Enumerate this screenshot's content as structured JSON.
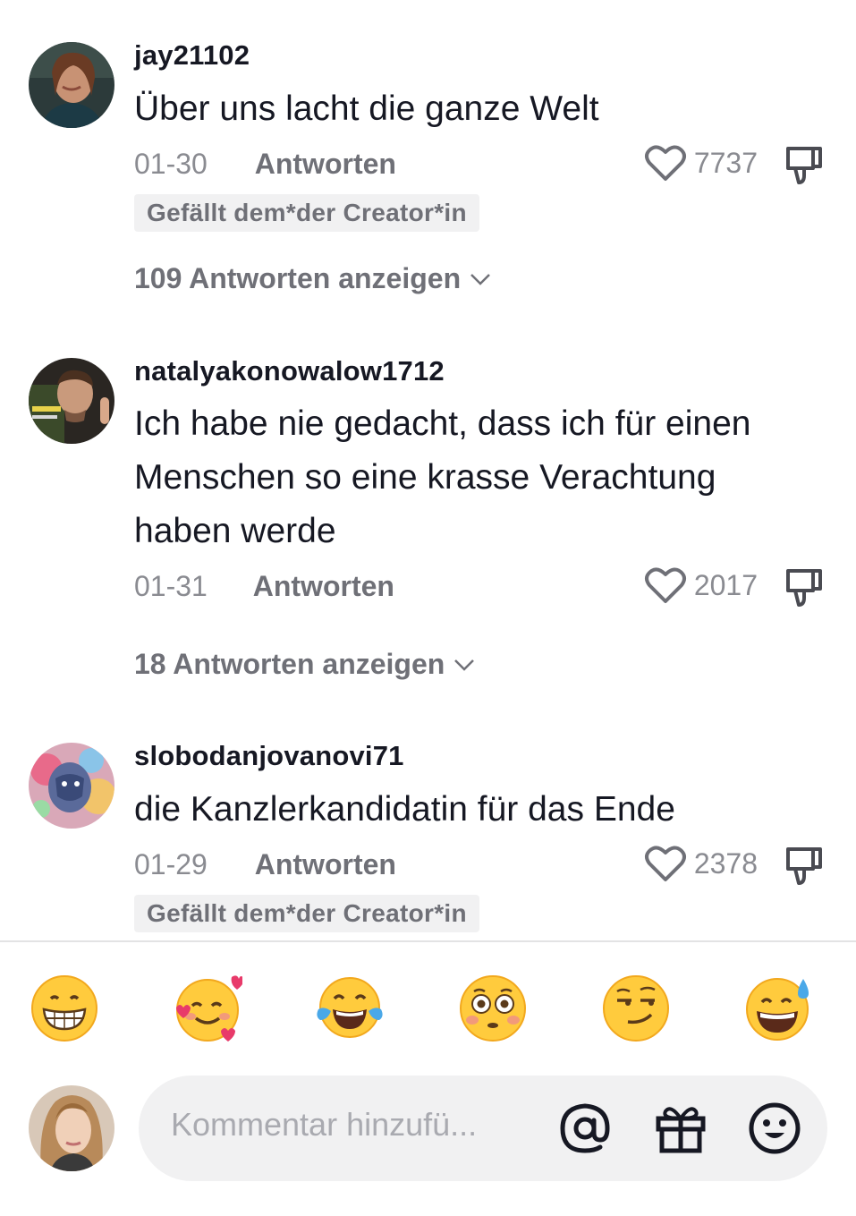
{
  "comments": [
    {
      "username": "jay21102",
      "text": "Über uns lacht die ganze Welt",
      "date": "01-30",
      "reply_label": "Antworten",
      "likes": "7737",
      "badge": "Gefällt dem*der Creator*in",
      "replies_label": "109 Antworten anzeigen"
    },
    {
      "username": "natalyakonowalow1712",
      "text": "Ich habe nie gedacht, dass ich für einen Menschen so eine krasse Verachtung haben werde",
      "date": "01-31",
      "reply_label": "Antworten",
      "likes": "2017",
      "replies_label": "18 Antworten anzeigen"
    },
    {
      "username": "slobodanjovanovi71",
      "text": "die Kanzlerkandidatin für das Ende",
      "date": "01-29",
      "reply_label": "Antworten",
      "likes": "2378",
      "badge": "Gefällt dem*der Creator*in"
    }
  ],
  "emoji_bar": [
    "grinning-face",
    "smiling-face-with-hearts",
    "face-with-tears-of-joy",
    "flushed-face",
    "smirking-face",
    "grinning-face-with-sweat"
  ],
  "composer": {
    "placeholder": "Kommentar hinzufü..."
  },
  "icons": {
    "like": "heart-outline-icon",
    "dislike": "thumbs-down-icon",
    "mention": "at-icon",
    "gift": "gift-icon",
    "emoji": "smiley-icon"
  },
  "colors": {
    "text": "#161823",
    "secondary": "#8a8b91",
    "badge_bg": "#f1f1f2"
  }
}
